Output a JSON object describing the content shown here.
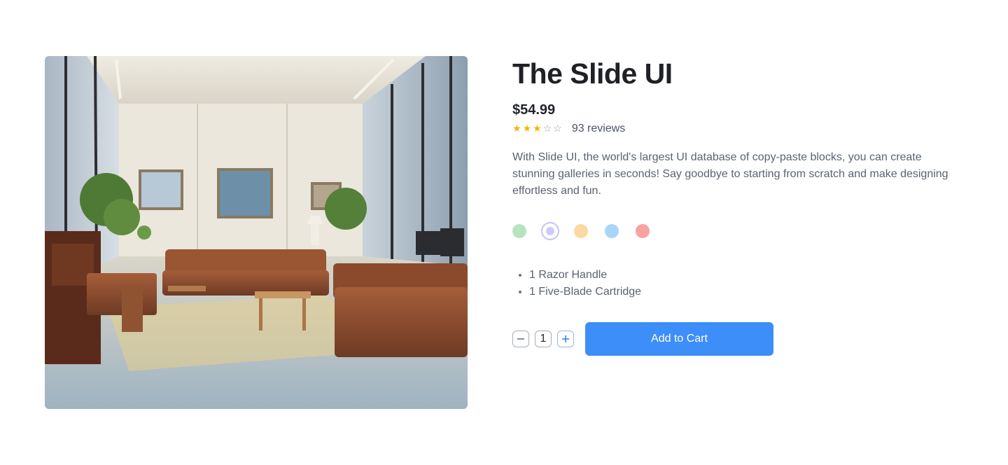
{
  "product": {
    "title": "The Slide UI",
    "price": "$54.99",
    "rating": 3,
    "rating_max": 5,
    "reviews_text": "93 reviews",
    "description": "With Slide UI, the world's largest UI database of copy-paste blocks, you can create stunning galleries in seconds! Say goodbye to starting from scratch and make designing effortless and fun.",
    "image_icon": "office-lounge-photo"
  },
  "colors": [
    "#b7e4bf",
    "#cfcaf8",
    "#fcd9a3",
    "#a9d5fa",
    "#f9a2a2"
  ],
  "selected_color_index": 1,
  "features": [
    "1 Razor Handle",
    "1 Five-Blade Cartridge"
  ],
  "quantity": {
    "value": "1",
    "minus_icon": "minus-icon",
    "plus_icon": "plus-icon"
  },
  "cart": {
    "label": "Add to Cart",
    "color": "#3d8ef8"
  },
  "star_color": "#f5b50a"
}
